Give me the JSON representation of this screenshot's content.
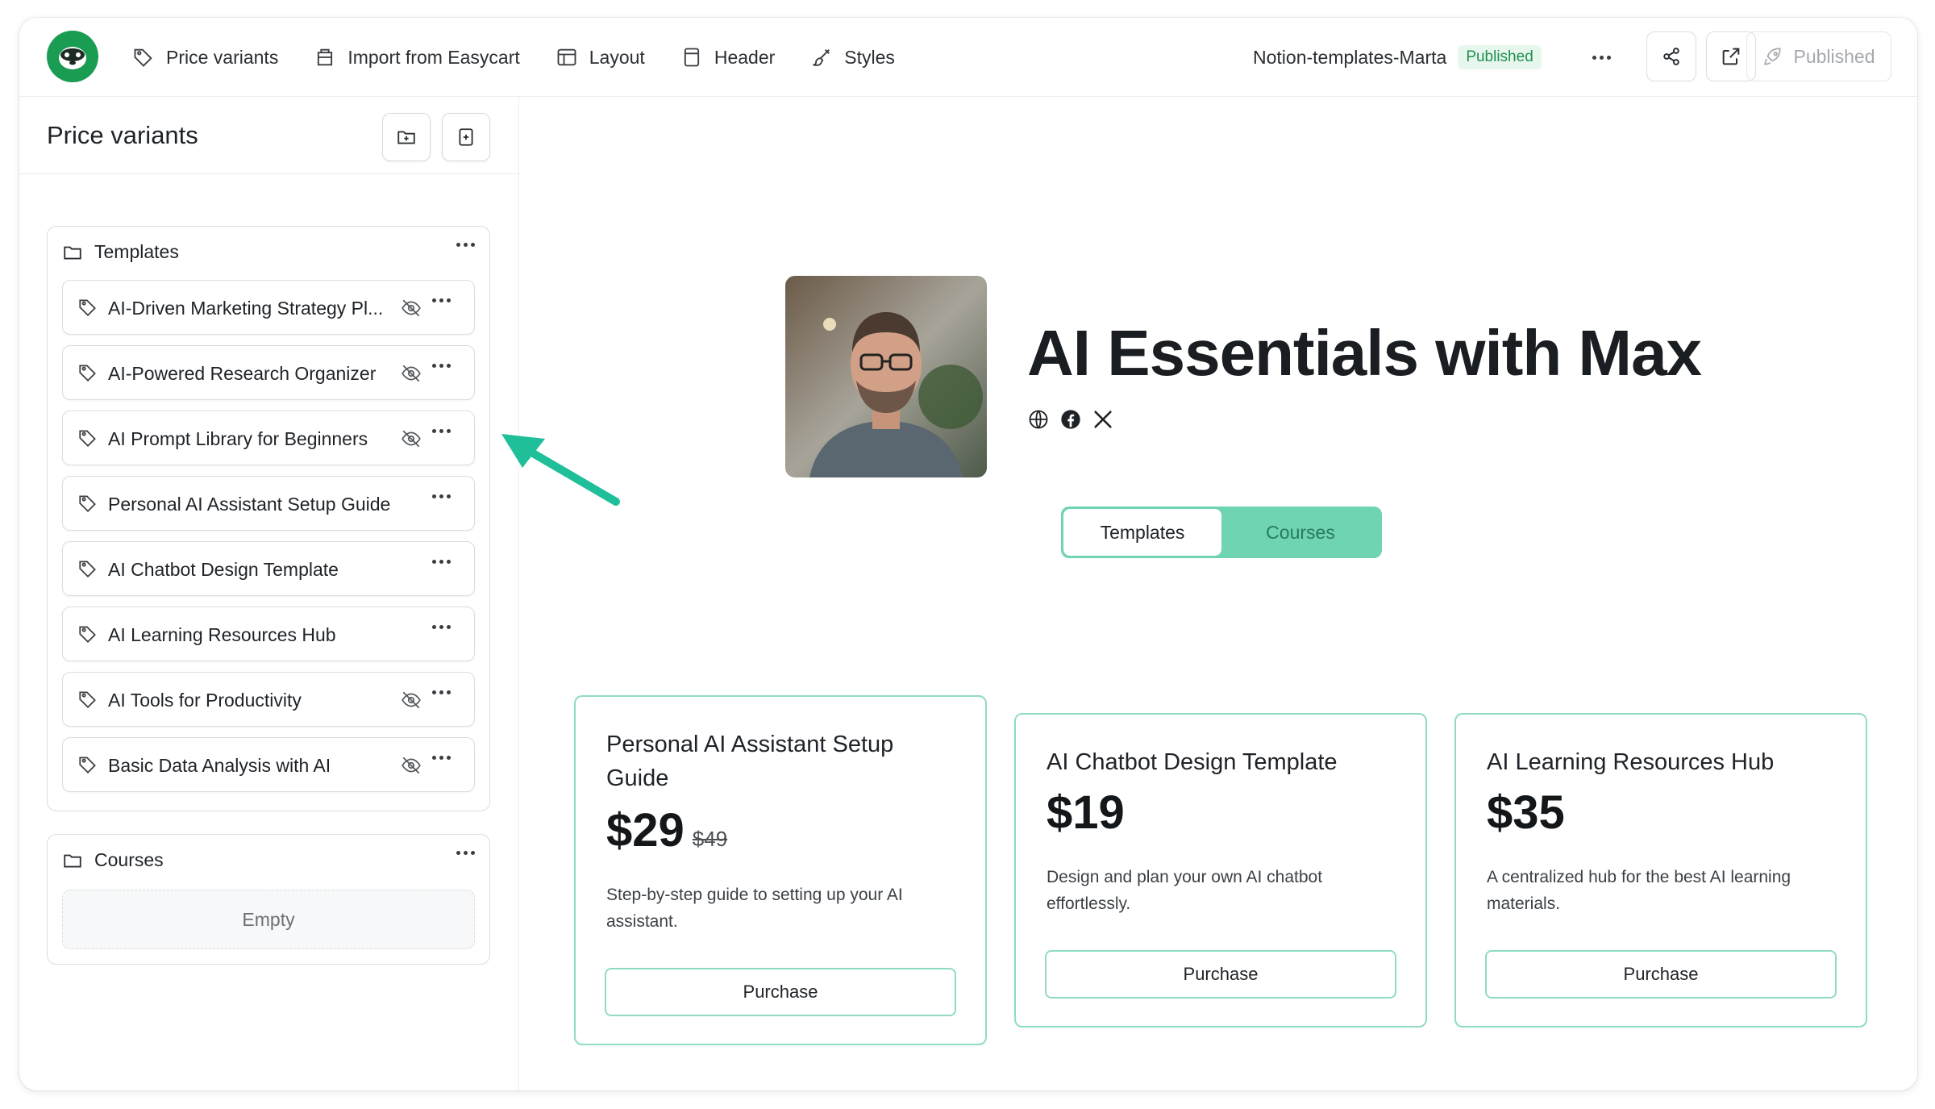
{
  "toolbar": {
    "nav": [
      {
        "label": "Price variants",
        "icon": "tag-icon"
      },
      {
        "label": "Import from Easycart",
        "icon": "import-icon"
      },
      {
        "label": "Layout",
        "icon": "layout-icon"
      },
      {
        "label": "Header",
        "icon": "header-icon"
      },
      {
        "label": "Styles",
        "icon": "brush-icon"
      }
    ],
    "site_name": "Notion-templates-Marta",
    "site_status": "Published",
    "publish_label": "Published"
  },
  "sidebar": {
    "title": "Price variants",
    "groups": [
      {
        "name": "Templates",
        "items": [
          {
            "label": "AI-Driven Marketing Strategy Pl...",
            "hidden": true
          },
          {
            "label": "AI-Powered Research Organizer",
            "hidden": true
          },
          {
            "label": "AI Prompt Library for Beginners",
            "hidden": true
          },
          {
            "label": "Personal AI Assistant Setup Guide",
            "hidden": false
          },
          {
            "label": "AI Chatbot Design Template",
            "hidden": false
          },
          {
            "label": "AI Learning Resources Hub",
            "hidden": false
          },
          {
            "label": "AI Tools for Productivity",
            "hidden": true
          },
          {
            "label": "Basic Data Analysis with AI",
            "hidden": true
          }
        ]
      },
      {
        "name": "Courses",
        "empty_label": "Empty"
      }
    ]
  },
  "profile": {
    "name": "AI Essentials with Max",
    "tabs": [
      "Templates",
      "Courses"
    ],
    "active_tab": "Templates"
  },
  "cards": [
    {
      "title": "Personal AI Assistant Setup Guide",
      "price": "$29",
      "old_price": "$49",
      "description": "Step-by-step guide to setting up your AI assistant.",
      "button": "Purchase"
    },
    {
      "title": "AI Chatbot Design Template",
      "price": "$19",
      "old_price": "",
      "description": "Design and plan your own AI chatbot effortlessly.",
      "button": "Purchase"
    },
    {
      "title": "AI Learning Resources Hub",
      "price": "$35",
      "old_price": "",
      "description": "A centralized hub for the best AI learning materials.",
      "button": "Purchase"
    }
  ],
  "colors": {
    "accent": "#6ed4b1",
    "card_border": "#8fdcc1",
    "brand": "#1a9c52",
    "arrow": "#1fbf99"
  }
}
